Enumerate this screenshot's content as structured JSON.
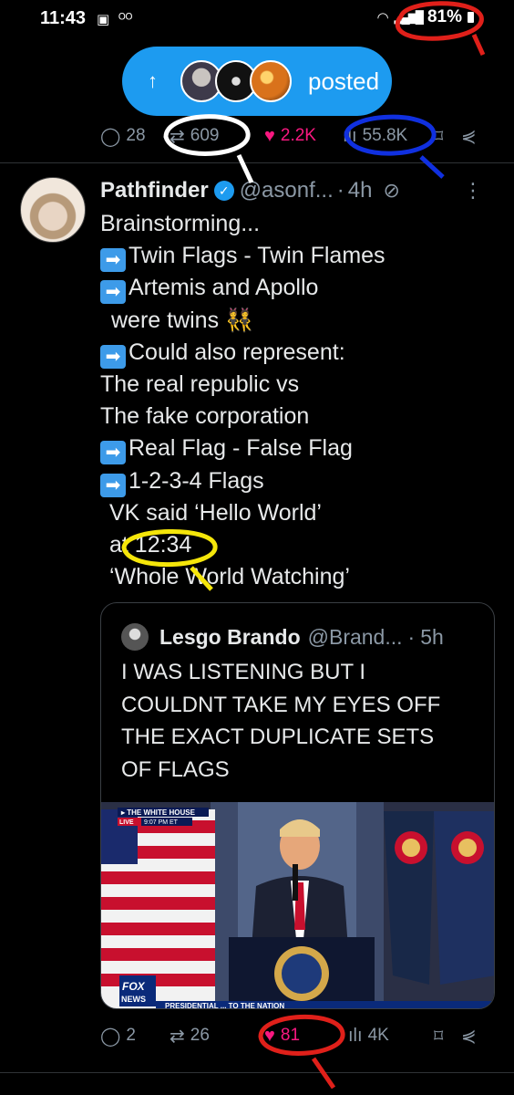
{
  "status_bar": {
    "time": "11:43",
    "battery": "81%"
  },
  "pill": {
    "label": "posted"
  },
  "top_actions": {
    "replies": "28",
    "reposts": "609",
    "likes": "2.2K",
    "views": "55.8K"
  },
  "tweet": {
    "name": "Pathfinder",
    "handle": "@asonf...",
    "time": "4h",
    "lines": [
      "Brainstorming...",
      "Twin Flags - Twin Flames",
      "Artemis and Apollo",
      "were twins 👯",
      "Could also represent:",
      "The real republic vs",
      "The fake corporation",
      "Real Flag - False Flag",
      "1-2-3-4 Flags",
      "VK said ‘Hello World’",
      "at 12:34",
      "‘Whole World Watching’"
    ]
  },
  "quote": {
    "name": "Lesgo Brando",
    "handle": "@Brand...",
    "time": "5h",
    "text_lines": [
      "I WAS LISTENING BUT I",
      "COULDNT TAKE MY EYES OFF",
      "THE EXACT DUPLICATE SETS",
      "OF FLAGS"
    ],
    "image": {
      "banner_title": "THE WHITE HOUSE",
      "banner_live": "LIVE",
      "banner_time": "9:07 PM ET",
      "logo": "FOX NEWS",
      "ticker": "PRESIDENTIAL ... TO THE NATION"
    }
  },
  "bottom_actions": {
    "replies": "2",
    "reposts": "26",
    "likes": "81",
    "views": "4K"
  },
  "colors": {
    "accent": "#1d9bf0",
    "like": "#f91880",
    "muted": "#8b98a5",
    "annotation_red": "#e0201a",
    "annotation_blue": "#1030e0",
    "annotation_yellow": "#f5e60a"
  }
}
